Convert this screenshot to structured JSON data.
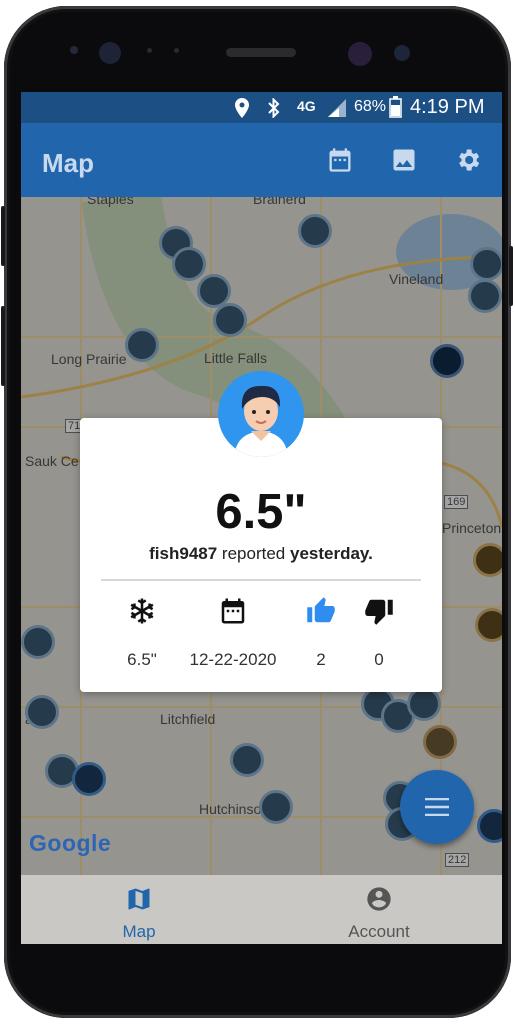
{
  "status_bar": {
    "network": "4G",
    "battery": "68%",
    "time": "4:19 PM"
  },
  "app_bar": {
    "title": "Map"
  },
  "map": {
    "labels": {
      "staples": "Staples",
      "brainerd": "Brainerd",
      "vineland": "Vineland",
      "long_prairie": "Long Prairie",
      "little_falls": "Little Falls",
      "sauk_centre": "Sauk Ce",
      "princeton": "Princeton",
      "litchfield": "Litchfield",
      "hutchinson": "Hutchinson",
      "highway_71": "71",
      "highway_169": "169",
      "highway_212": "212",
      "partial_far": "ar"
    },
    "google_logo": "Google"
  },
  "report_card": {
    "value": "6.5\"",
    "user": "fish9487",
    "reported_word": "reported",
    "when": "yesterday.",
    "stats": {
      "thickness": "6.5\"",
      "date": "12-22-2020",
      "likes": "2",
      "dislikes": "0"
    }
  },
  "bottom_nav": {
    "map_label": "Map",
    "account_label": "Account"
  },
  "colors": {
    "primary": "#2166ad",
    "status_bar": "#1c4f84",
    "like": "#2f8df0"
  }
}
